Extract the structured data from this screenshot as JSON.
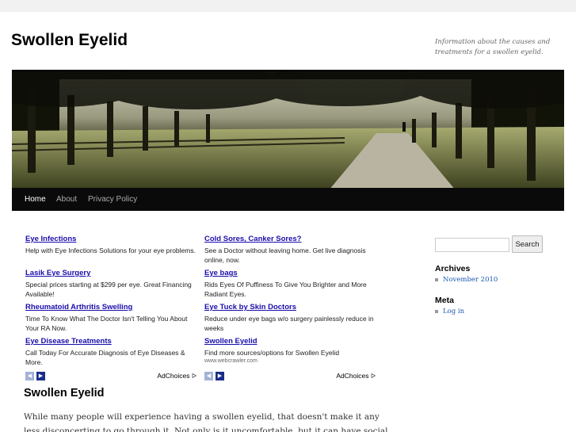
{
  "site": {
    "title": "Swollen Eyelid",
    "tagline": "Information about the causes and treatments for a swollen eyelid."
  },
  "nav": {
    "items": [
      {
        "label": "Home",
        "active": true
      },
      {
        "label": "About",
        "active": false
      },
      {
        "label": "Privacy Policy",
        "active": false
      }
    ]
  },
  "ads": {
    "left": {
      "entries": [
        {
          "title": "Eye Infections",
          "desc": "Help with Eye Infections Solutions for your eye problems."
        },
        {
          "title": "Lasik Eye Surgery",
          "desc": "Special prices starting at $299 per eye. Great Financing Available!"
        },
        {
          "title": "Rheumatoid Arthritis Swelling",
          "desc": "Time To Know What The Doctor Isn't Telling You About Your RA Now."
        },
        {
          "title": "Eye Disease Treatments",
          "desc": "Call Today For Accurate Diagnosis of Eye Diseases & More."
        }
      ],
      "adchoices": "AdChoices"
    },
    "right": {
      "entries": [
        {
          "title": "Cold Sores, Canker Sores?",
          "desc": "See a Doctor without leaving home. Get live diagnosis online, now."
        },
        {
          "title": "Eye bags",
          "desc": "Rids Eyes Of Puffiness To Give You Brighter and More Radiant Eyes."
        },
        {
          "title": "Eye Tuck by Skin Doctors",
          "desc": "Reduce under eye bags w/o surgery painlessly reduce in weeks"
        },
        {
          "title": "Swollen Eyelid",
          "desc": "Find more sources/options for Swollen Eyelid",
          "url": "www.webcrawler.com"
        }
      ],
      "adchoices": "AdChoices"
    },
    "prev_glyph": "◀",
    "next_glyph": "▶",
    "adchoices_glyph": "ᐅ"
  },
  "post": {
    "title": "Swollen Eyelid",
    "body": "While many people will experience having a swollen eyelid, that doesn't make it any less disconcerting to go through it. Not only is it uncomfortable, but it can have social"
  },
  "sidebar": {
    "search_button": "Search",
    "archives_title": "Archives",
    "archives": [
      "November 2010"
    ],
    "meta_title": "Meta",
    "meta": [
      "Log in"
    ]
  },
  "colors": {
    "link": "#1a0dab",
    "nav_bg": "#0a0a0a",
    "sidebar_link": "#1b57b1"
  }
}
